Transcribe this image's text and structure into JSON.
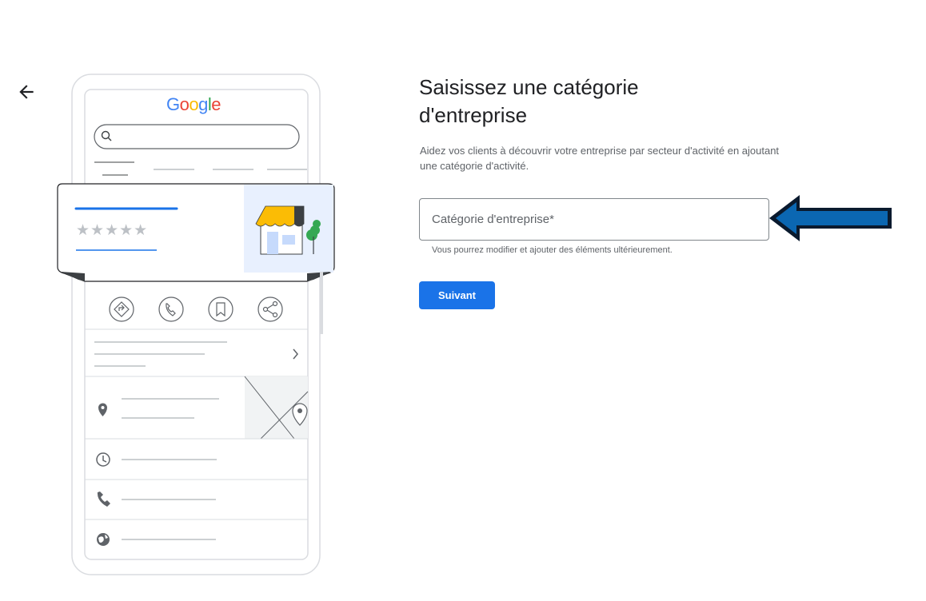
{
  "header": {
    "back_icon": "arrow-back-icon"
  },
  "main": {
    "title": "Saisissez une catégorie d'entreprise",
    "subtitle": "Aidez vos clients à découvrir votre entreprise par secteur d'activité en ajoutant une catégorie d'activité.",
    "category_field": {
      "placeholder": "Catégorie d'entreprise*",
      "value": ""
    },
    "helper_text": "Vous pourrez modifier et ajouter des éléments ultérieurement.",
    "next_button": "Suivant"
  },
  "illustration": {
    "logo_letters": [
      "G",
      "o",
      "o",
      "g",
      "l",
      "e"
    ],
    "rating_stars": "★★★★★",
    "icons": [
      "search-icon",
      "directions-icon",
      "phone-icon",
      "bookmark-icon",
      "share-icon",
      "chevron-right-icon",
      "location-pin-icon",
      "clock-icon",
      "phone-icon",
      "globe-icon",
      "storefront-icon"
    ]
  },
  "annotation": {
    "arrow_color": "#0b67b2",
    "arrow_outline": "#0a1a2e"
  },
  "colors": {
    "accent": "#1a73e8"
  }
}
